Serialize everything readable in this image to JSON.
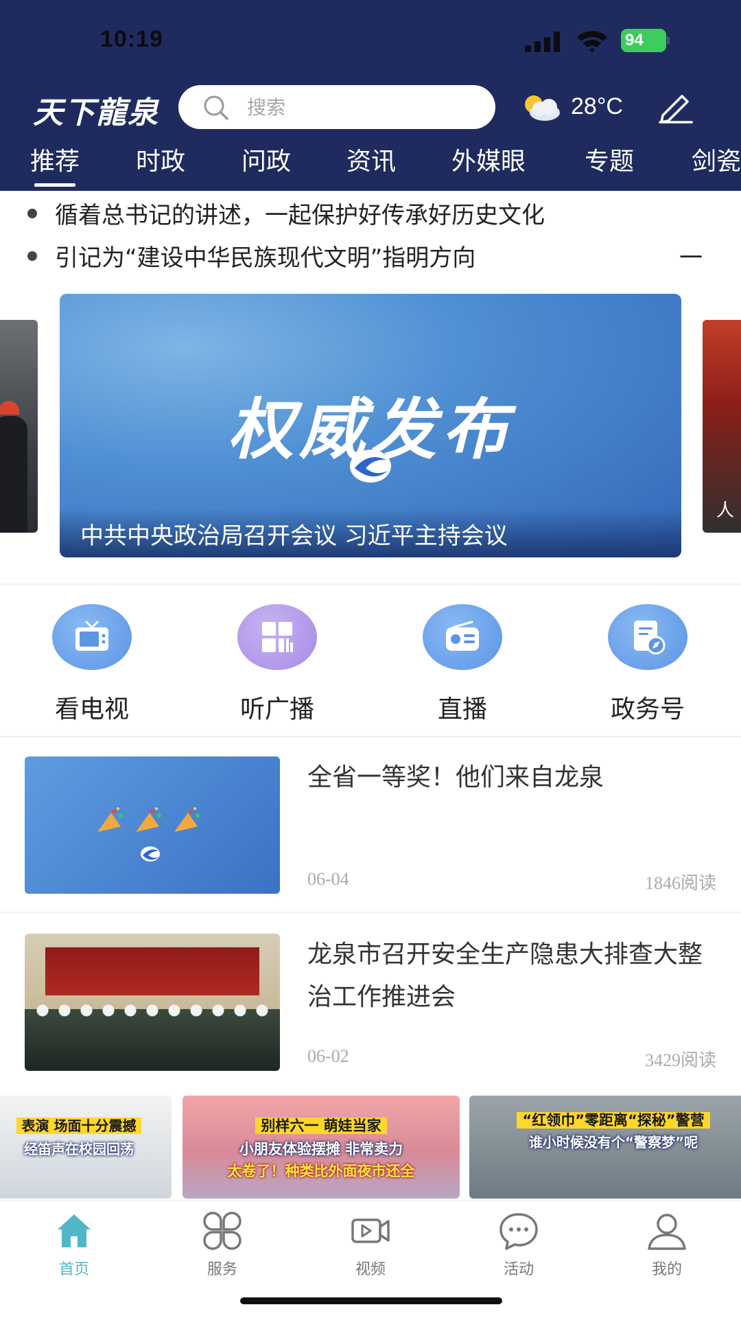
{
  "status_bar": {
    "time": "10:19",
    "battery": "94"
  },
  "header": {
    "brand": "天下龍泉",
    "search_placeholder": "搜索",
    "weather_temp": "28°C",
    "tabs": [
      "推荐",
      "时政",
      "问政",
      "资讯",
      "外媒眼",
      "专题",
      "剑瓷"
    ],
    "active_tab": "推荐"
  },
  "ticker": [
    {
      "text": "循着总书记的讲述，一起保护好传承好历史文化"
    },
    {
      "text": "引记为“建设中华民族现代文明”指明方向",
      "tail": "一"
    }
  ],
  "carousel": {
    "main_title": "权威发布",
    "caption": "中共中央政治局召开会议 习近平主持会议",
    "side_right_caption": "人"
  },
  "quick_access": [
    {
      "label": "看电视",
      "icon": "tv-icon",
      "color": "#5b95e6"
    },
    {
      "label": "听广播",
      "icon": "grid-icon",
      "color": "#a88ae6"
    },
    {
      "label": "直播",
      "icon": "radio-icon",
      "color": "#5b95e6"
    },
    {
      "label": "政务号",
      "icon": "document-icon",
      "color": "#5b95e6"
    }
  ],
  "news": [
    {
      "title": "全省一等奖！他们来自龙泉",
      "date": "06-04",
      "reads": "1846阅读",
      "thumb_icon": "party-popper-icon"
    },
    {
      "title": "龙泉市召开安全生产隐患大排查大整治工作推进会",
      "date": "06-02",
      "reads": "3429阅读",
      "thumb_icon": "meeting-photo"
    }
  ],
  "videos": [
    {
      "line1": "表演 场面十分震撼",
      "line2": "经笛声在校园回荡"
    },
    {
      "line1": "别样六一 萌娃当家",
      "line2": "小朋友体验摆摊 非常卖力",
      "line3": "太卷了！种类比外面夜市还全"
    },
    {
      "line1": "“红领巾”零距离“探秘”警营",
      "line2": "谁小时候没有个“警察梦”呢"
    }
  ],
  "bottom_nav": [
    {
      "label": "首页",
      "icon": "home-icon",
      "active": true
    },
    {
      "label": "服务",
      "icon": "services-icon",
      "active": false
    },
    {
      "label": "视频",
      "icon": "video-icon",
      "active": false
    },
    {
      "label": "活动",
      "icon": "chat-icon",
      "active": false
    },
    {
      "label": "我的",
      "icon": "profile-icon",
      "active": false
    }
  ],
  "colors": {
    "header_bg": "#1f2b5e",
    "accent": "#4fb7c7",
    "battery": "#3ccd5c"
  }
}
